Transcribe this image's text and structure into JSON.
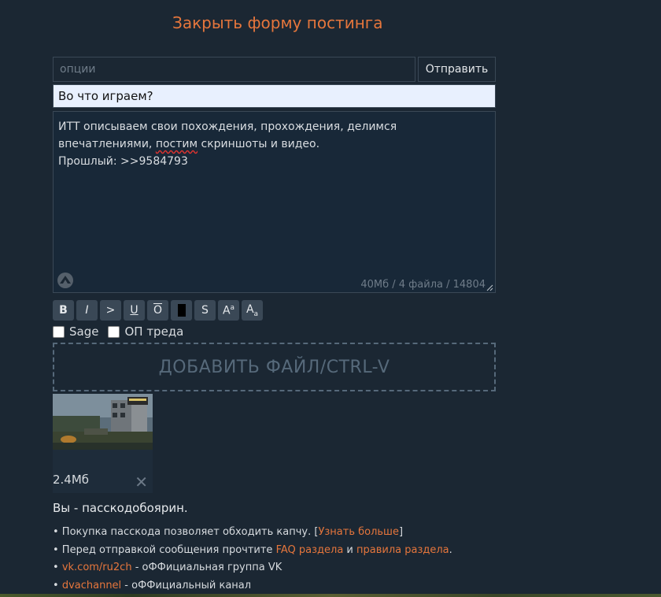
{
  "header": {
    "close_form": "Закрыть форму постинга"
  },
  "form": {
    "options_placeholder": "опции",
    "send_label": "Отправить",
    "subject_value": "Во что играем?",
    "comment": {
      "line1": "ИТТ описываем свои похождения, прохождения, делимся",
      "line2_a": "впечатлениями, ",
      "line2_misspelled": "постим",
      "line2_b": " скриншоты и видео.",
      "line3": "Прошлый: >>9584793"
    },
    "limits": "40Мб / 4 файла / 14804"
  },
  "toolbar": {
    "bold": "B",
    "italic": "I",
    "quote": ">",
    "underline": "U",
    "overline": "O",
    "strike": "S",
    "sup_main": "A",
    "sup_small": "a",
    "sub_main": "A",
    "sub_small": "a"
  },
  "checkboxes": {
    "sage": "Sage",
    "op": "ОП треда"
  },
  "dropzone": {
    "label": "ДОБАВИТЬ ФАЙЛ/CTRL-V"
  },
  "attachment": {
    "size": "2.4Мб",
    "remove": "✕"
  },
  "passcode": {
    "title": "Вы - пасскодобоярин.",
    "notes": [
      {
        "bullet": "•",
        "pre": " Покупка пасскода позволяет обходить капчу. [",
        "link": "Узнать больше",
        "post": "]"
      },
      {
        "bullet": "•",
        "pre": " Перед отправкой сообщения прочтите ",
        "link": "FAQ раздела",
        "mid": " и ",
        "link2": "правила раздела",
        "post": "."
      },
      {
        "bullet": "•",
        "pre": " ",
        "link": "vk.com/ru2ch",
        "post": " - оФФициальная группа VK"
      },
      {
        "bullet": "•",
        "pre": " ",
        "link": "dvachannel",
        "post": " - оФФициальный канал"
      }
    ]
  },
  "colors": {
    "background": "#1b2733",
    "accent": "#e6763c",
    "muted": "#56697a"
  }
}
